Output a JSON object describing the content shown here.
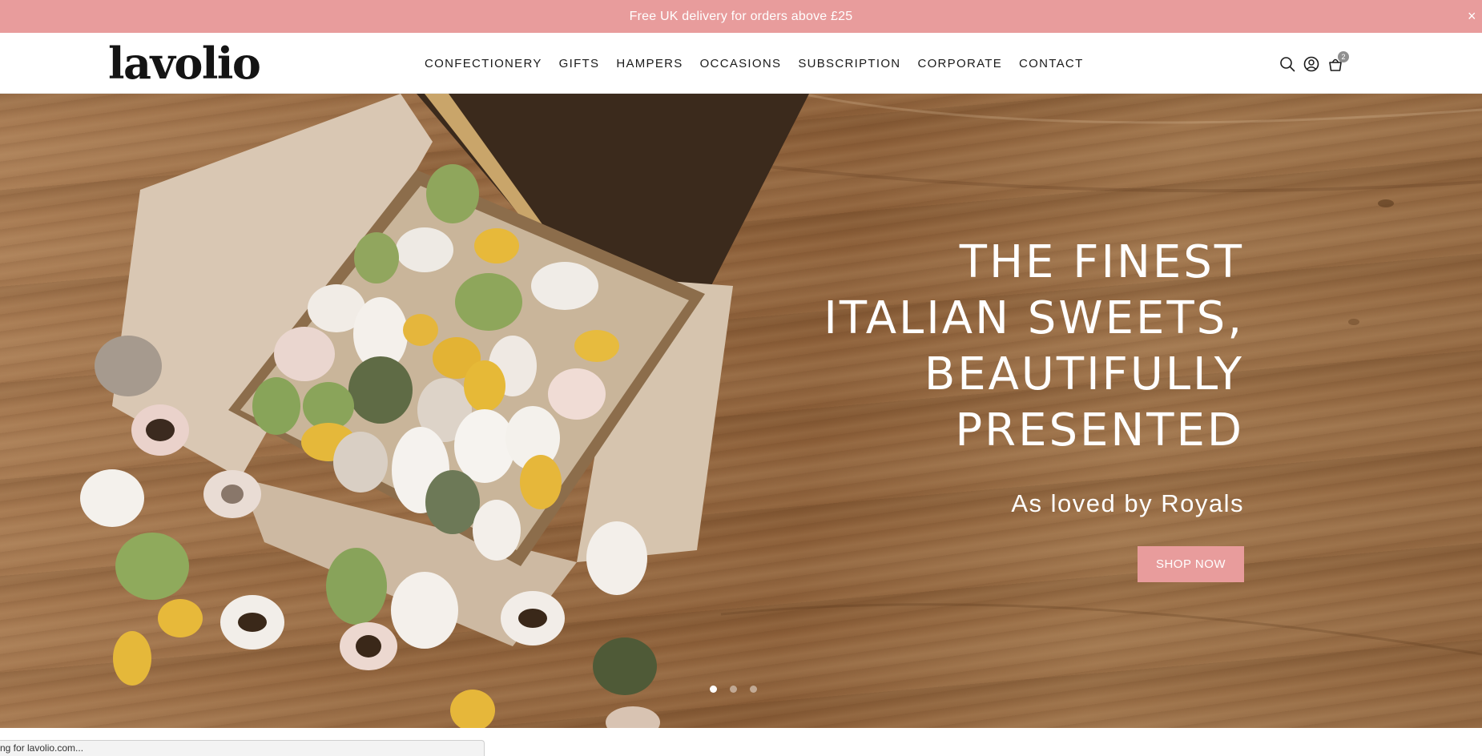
{
  "announcement": {
    "text": "Free UK delivery for orders above £25",
    "close_glyph": "×",
    "background": "#e89c9c"
  },
  "header": {
    "logo": "lavolio",
    "nav": [
      {
        "label": "CONFECTIONERY"
      },
      {
        "label": "GIFTS"
      },
      {
        "label": "HAMPERS"
      },
      {
        "label": "OCCASIONS"
      },
      {
        "label": "SUBSCRIPTION"
      },
      {
        "label": "CORPORATE"
      },
      {
        "label": "CONTACT"
      }
    ],
    "icons": [
      "search-icon",
      "account-icon",
      "cart-icon"
    ],
    "cart_count": "2"
  },
  "hero": {
    "title_lines": [
      "THE FINEST",
      "ITALIAN SWEETS,",
      "BEAUTIFULLY",
      "PRESENTED"
    ],
    "subtitle": "As loved by Royals",
    "cta_label": "SHOP NOW",
    "cta_color": "#e89c9c",
    "slides_total": 3,
    "active_slide": 1
  },
  "status_bar": {
    "text": "ng for lavolio.com..."
  }
}
